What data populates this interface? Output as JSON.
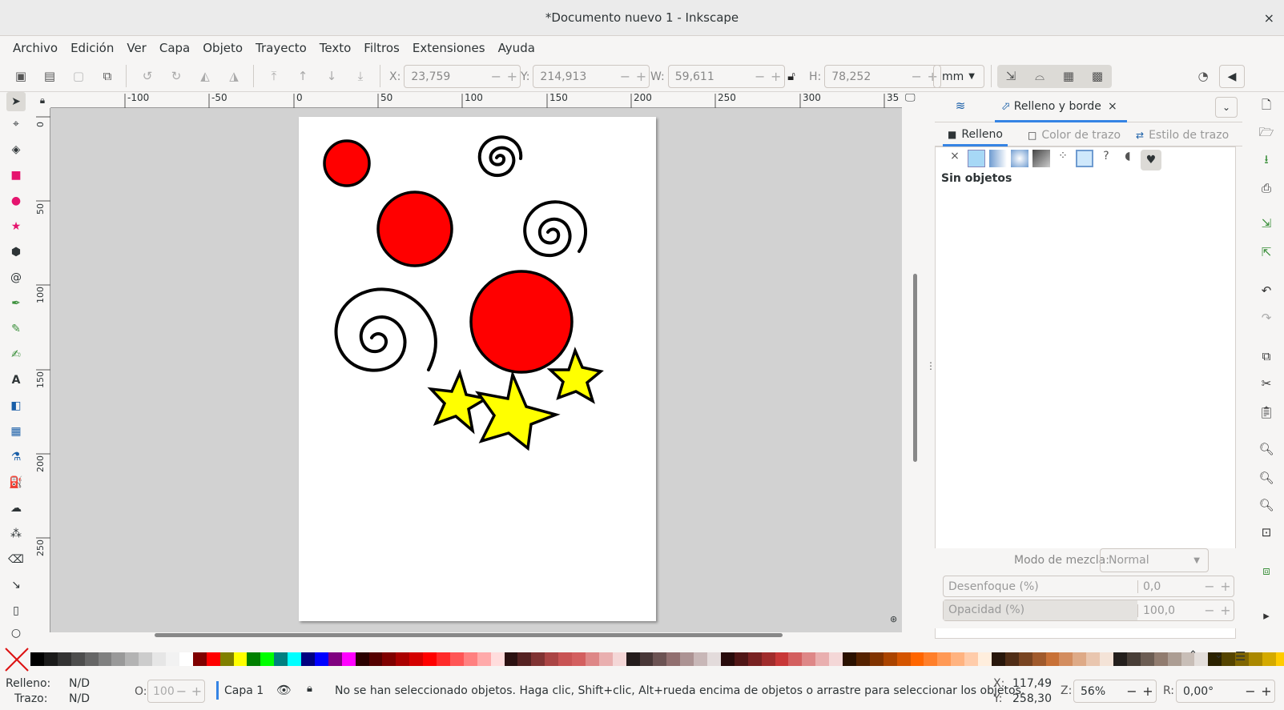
{
  "window": {
    "title": "*Documento nuevo 1 - Inkscape",
    "close": "×"
  },
  "menu": [
    "Archivo",
    "Edición",
    "Ver",
    "Capa",
    "Objeto",
    "Trayecto",
    "Texto",
    "Filtros",
    "Extensiones",
    "Ayuda"
  ],
  "toolbar": {
    "x": {
      "label": "X:",
      "value": "23,759"
    },
    "y": {
      "label": "Y:",
      "value": "214,913"
    },
    "w": {
      "label": "W:",
      "value": "59,611"
    },
    "h": {
      "label": "H:",
      "value": "78,252"
    },
    "unit": "mm",
    "minus": "−",
    "plus": "+"
  },
  "ruler": {
    "h_ticks": [
      "-100",
      "-50",
      "0",
      "50",
      "100",
      "150",
      "200",
      "250",
      "300",
      "35"
    ],
    "v_ticks": [
      "0",
      "50",
      "100",
      "150",
      "200",
      "250"
    ]
  },
  "panel": {
    "tab_title": "Relleno y borde",
    "tab_close": "×",
    "subtabs": [
      "Relleno",
      "Color de trazo",
      "Estilo de trazo"
    ],
    "message": "Sin objetos",
    "blend_label": "Modo de mezcla:",
    "blend_value": "Normal",
    "blur_label": "Desenfoque (%)",
    "blur_value": "0,0",
    "opacity_label": "Opacidad (%)",
    "opacity_value": "100,0"
  },
  "status": {
    "fill_label": "Relleno:",
    "fill_value": "N/D",
    "stroke_label": "Trazo:",
    "stroke_value": "N/D",
    "o_label": "O:",
    "o_value": "100",
    "layer": "Capa 1",
    "message": "No se han seleccionado objetos. Haga clic, Shift+clic, Alt+rueda encima de objetos o arrastre para seleccionar los objetos.",
    "x_label": "X:",
    "x_value": "117,49",
    "y_label": "Y:",
    "y_value": "258,30",
    "z_label": "Z:",
    "z_value": "56%",
    "r_label": "R:",
    "r_value": "0,00°"
  },
  "colors": {
    "red": "#ff0000",
    "yellow": "#ffff00",
    "accent": "#3584e4"
  }
}
